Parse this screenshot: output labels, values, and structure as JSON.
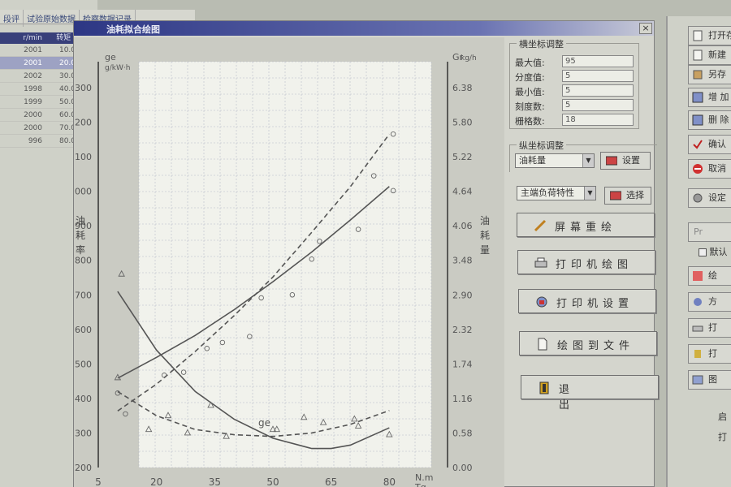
{
  "background_window": {
    "tabs": [
      "段评",
      "试验原始数据",
      "检察数据记录"
    ],
    "table_headers": [
      "r/min",
      "转矩 N"
    ],
    "rows": [
      {
        "rpm": "2001",
        "tq": "10.0"
      },
      {
        "rpm": "2001",
        "tq": "20.0"
      },
      {
        "rpm": "2002",
        "tq": "30.0"
      },
      {
        "rpm": "1998",
        "tq": "40.0"
      },
      {
        "rpm": "1999",
        "tq": "50.0"
      },
      {
        "rpm": "2000",
        "tq": "60.0"
      },
      {
        "rpm": "2000",
        "tq": "70.0"
      },
      {
        "rpm": "996",
        "tq": "80.0"
      }
    ],
    "selected_row": 1
  },
  "right_panel": {
    "buttons": [
      "打开存",
      "新建",
      "另存",
      "增 加",
      "删 除",
      "确认",
      "取消",
      "设定"
    ],
    "combo": "Pr",
    "checkbox_label": "默认",
    "small_buttons": [
      "绘",
      "方",
      "打",
      "打",
      "图"
    ],
    "tail_labels": [
      "启",
      "打"
    ]
  },
  "dialog": {
    "title": "油耗拟合绘图",
    "close_glyph": "×",
    "x_group": {
      "title": "横坐标调整",
      "fields": [
        {
          "label": "最大值:",
          "value": "95"
        },
        {
          "label": "分度值:",
          "value": "5"
        },
        {
          "label": "最小值:",
          "value": "5"
        },
        {
          "label": "刻度数:",
          "value": "5"
        },
        {
          "label": "栅格数:",
          "value": "18"
        }
      ]
    },
    "y_group": {
      "title": "纵坐标调整",
      "combo1": "油耗量",
      "set_button": "设置",
      "combo2": "主端负荷特性",
      "select_button": "选择"
    },
    "buttons": {
      "redraw": "屏幕重绘",
      "print_plot": "打印机绘图",
      "print_setup": "打印机设置",
      "plot_to_file": "绘图到文件",
      "exit": "退 出"
    }
  },
  "chart_data": {
    "type": "line",
    "x_ticks": [
      "5",
      "20",
      "35",
      "50",
      "65",
      "80"
    ],
    "xlabel": "Tq",
    "x_unit": "N.m",
    "xlim": [
      5,
      95
    ],
    "left_axis": {
      "unit_top": "ge",
      "unit": "g/kW·h",
      "ticks": [
        "200",
        "300",
        "400",
        "500",
        "600",
        "700",
        "800",
        "900",
        "1000",
        "1100",
        "1200",
        "1300"
      ],
      "range": [
        200,
        1300
      ],
      "label": "油耗率"
    },
    "right_axis": {
      "unit_top": "Gr",
      "unit": "kg/h",
      "ticks": [
        "0.00",
        "0.58",
        "1.16",
        "1.74",
        "2.32",
        "2.90",
        "3.48",
        "4.06",
        "4.64",
        "5.22",
        "5.80",
        "6.38"
      ],
      "range": [
        0,
        6.38
      ],
      "label": "油耗量"
    },
    "curve_label": "ge",
    "series": [
      {
        "axis": "left",
        "style": "solid",
        "x": [
          10,
          20,
          30,
          40,
          50,
          60,
          65,
          70,
          80
        ],
        "y": [
          710,
          540,
          420,
          340,
          285,
          255,
          255,
          265,
          315
        ]
      },
      {
        "axis": "left",
        "style": "dashed",
        "x": [
          10,
          20,
          30,
          40,
          50,
          60,
          70,
          80
        ],
        "y": [
          420,
          350,
          310,
          295,
          290,
          300,
          325,
          365
        ]
      },
      {
        "axis": "right",
        "style": "solid",
        "x": [
          10,
          20,
          30,
          40,
          50,
          60,
          70,
          80
        ],
        "y": [
          1.5,
          1.85,
          2.22,
          2.65,
          3.12,
          3.62,
          4.16,
          4.72
        ]
      },
      {
        "axis": "right",
        "style": "dashed",
        "x": [
          10,
          20,
          30,
          40,
          50,
          60,
          70,
          80
        ],
        "y": [
          0.95,
          1.4,
          1.95,
          2.55,
          3.2,
          3.95,
          4.72,
          5.6
        ]
      }
    ],
    "markers": [
      {
        "axis": "left",
        "x": [
          11,
          18,
          28,
          38,
          51,
          63,
          71,
          80
        ],
        "y": [
          760,
          310,
          300,
          290,
          310,
          330,
          340,
          295
        ]
      },
      {
        "axis": "right",
        "x": [
          10,
          22,
          33,
          44,
          55,
          60,
          72,
          81
        ],
        "y": [
          1.25,
          1.55,
          2.0,
          2.2,
          2.9,
          3.5,
          4.0,
          4.65
        ]
      },
      {
        "axis": "left",
        "x": [
          10,
          23,
          34,
          50,
          58,
          72
        ],
        "y": [
          460,
          350,
          380,
          310,
          345,
          320
        ]
      },
      {
        "axis": "right",
        "x": [
          12,
          27,
          37,
          47,
          62,
          76,
          81
        ],
        "y": [
          0.9,
          1.6,
          2.1,
          2.85,
          3.8,
          4.9,
          5.6
        ]
      }
    ]
  }
}
